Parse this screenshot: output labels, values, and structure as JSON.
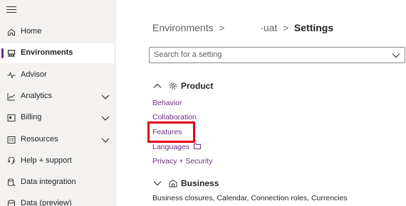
{
  "sidebar": {
    "items": [
      {
        "label": "Home",
        "icon": "home-icon",
        "has_chevron": false,
        "active": false
      },
      {
        "label": "Environments",
        "icon": "environments-icon",
        "has_chevron": false,
        "active": true
      },
      {
        "label": "Advisor",
        "icon": "advisor-icon",
        "has_chevron": false,
        "active": false
      },
      {
        "label": "Analytics",
        "icon": "analytics-icon",
        "has_chevron": true,
        "active": false
      },
      {
        "label": "Billing",
        "icon": "billing-icon",
        "has_chevron": true,
        "active": false
      },
      {
        "label": "Resources",
        "icon": "resources-icon",
        "has_chevron": true,
        "active": false
      },
      {
        "label": "Help + support",
        "icon": "help-icon",
        "has_chevron": false,
        "active": false
      },
      {
        "label": "Data integration",
        "icon": "data-integration-icon",
        "has_chevron": false,
        "active": false
      },
      {
        "label": "Data (preview)",
        "icon": "data-preview-icon",
        "has_chevron": false,
        "active": false
      }
    ]
  },
  "breadcrumb": {
    "root": "Environments",
    "separator": ">",
    "environment": "·uat",
    "current": "Settings"
  },
  "search": {
    "placeholder": "Search for a setting"
  },
  "groups": {
    "product": {
      "title": "Product",
      "links": [
        "Behavior",
        "Collaboration",
        "Features",
        "Languages",
        "Privacy + Security"
      ]
    },
    "business": {
      "title": "Business",
      "summary": "Business closures, Calendar, Connection roles, Currencies"
    }
  },
  "colors": {
    "accent": "#6b2d80",
    "highlight": "#e3001b",
    "sidebar_bg": "#f3f2f1"
  }
}
